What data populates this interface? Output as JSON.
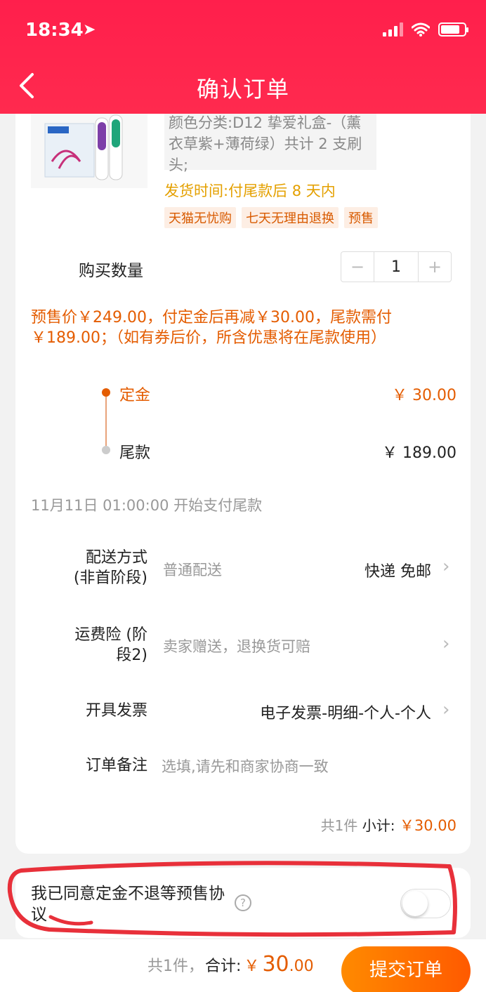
{
  "status_bar": {
    "time": "18:34",
    "location_glyph": "➤"
  },
  "header": {
    "title": "确认订单"
  },
  "product": {
    "sku": "颜色分类:D12 挚爱礼盒-（薰衣草紫+薄荷绿）共计 2 支刷头;",
    "ship_time": "发货时间:付尾款后 8 天内",
    "tags": [
      "天猫无忧购",
      "七天无理由退换",
      "预售"
    ]
  },
  "quantity": {
    "label": "购买数量",
    "minus": "−",
    "value": "1",
    "plus": "+"
  },
  "presale_notice": "预售价￥249.00，付定金后再减￥30.00，尾款需付￥189.00；（如有券后价，所含优惠将在尾款使用）",
  "payment_stages": {
    "deposit_label": "定金",
    "deposit_amount": "￥ 30.00",
    "final_label": "尾款",
    "final_amount": "￥ 189.00"
  },
  "final_pay_start": "11月11日 01:00:00 开始支付尾款",
  "delivery": {
    "label": "配送方式\n(非首阶段)",
    "value": "普通配送",
    "method": "快递 免邮"
  },
  "shipping_insurance": {
    "label": "运费险 (阶\n段2)",
    "value": "卖家赠送，退换货可赔"
  },
  "invoice": {
    "label": "开具发票",
    "value": "电子发票-明细-个人-个人"
  },
  "order_note": {
    "label": "订单备注",
    "placeholder": "选填,请先和商家协商一致"
  },
  "subtotal": {
    "count": "共1件",
    "label": "小计:",
    "value": "￥30.00"
  },
  "agreement": {
    "text": "我已同意定金不退等预售协议",
    "help": "?"
  },
  "bottom_bar": {
    "count": "共1件，",
    "label": "合计:",
    "currency": "￥",
    "amount": "30",
    "decimals": ".00",
    "submit": "提交订单"
  },
  "colors": {
    "header": "#ff2a4e",
    "accent": "#e45c00",
    "ship_time": "#e4a000",
    "submit_start": "#ff8a00",
    "submit_end": "#ff5a00",
    "annotation": "#e8303a"
  }
}
